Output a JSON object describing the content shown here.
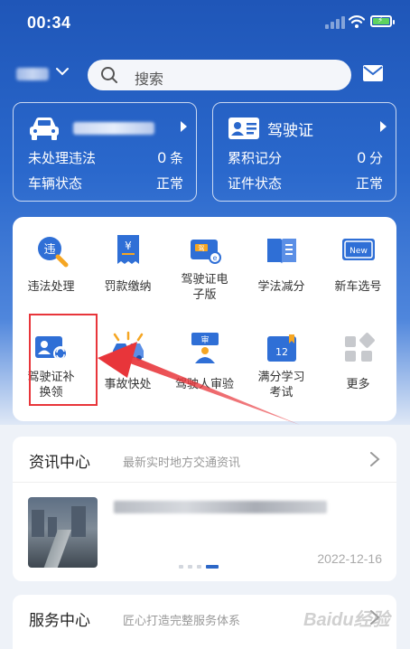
{
  "status_bar": {
    "time": "00:34"
  },
  "search": {
    "placeholder": "搜索"
  },
  "vehicle_card": {
    "rows": [
      {
        "label": "未处理违法",
        "value": "0",
        "unit": "条"
      },
      {
        "label": "车辆状态",
        "value": "正常"
      }
    ]
  },
  "license_card": {
    "title": "驾驶证",
    "rows": [
      {
        "label": "累积记分",
        "value": "0",
        "unit": "分"
      },
      {
        "label": "证件状态",
        "value": "正常"
      }
    ]
  },
  "services": [
    {
      "label": "违法处理",
      "icon": "violation-magnifier-icon"
    },
    {
      "label": "罚款缴纳",
      "icon": "fine-receipt-icon"
    },
    {
      "label": "驾驶证电子版",
      "label_lines": [
        "驾驶证电",
        "子版"
      ],
      "icon": "e-license-icon"
    },
    {
      "label": "学法减分",
      "icon": "study-book-icon"
    },
    {
      "label": "新车选号",
      "icon": "new-plate-icon"
    },
    {
      "label": "驾驶证补换领",
      "label_lines": [
        "驾驶证补",
        "换领"
      ],
      "icon": "license-reissue-icon"
    },
    {
      "label": "事故快处",
      "icon": "accident-cars-icon"
    },
    {
      "label": "驾驶人审验",
      "icon": "driver-review-icon"
    },
    {
      "label": "满分学习考试",
      "label_lines": [
        "满分学习",
        "考试"
      ],
      "icon": "study-calendar-12-icon"
    },
    {
      "label": "更多",
      "icon": "more-grid-icon"
    }
  ],
  "news": {
    "title": "资讯中心",
    "subtitle": "最新实时地方交通资讯",
    "date": "2022-12-16",
    "active_page": 4,
    "page_count": 4
  },
  "service_center": {
    "title": "服务中心",
    "subtitle": "匠心打造完整服务体系"
  },
  "watermark": "Baidu经验",
  "colors": {
    "brand_blue": "#2a68cc",
    "highlight_red": "#e8353a"
  }
}
